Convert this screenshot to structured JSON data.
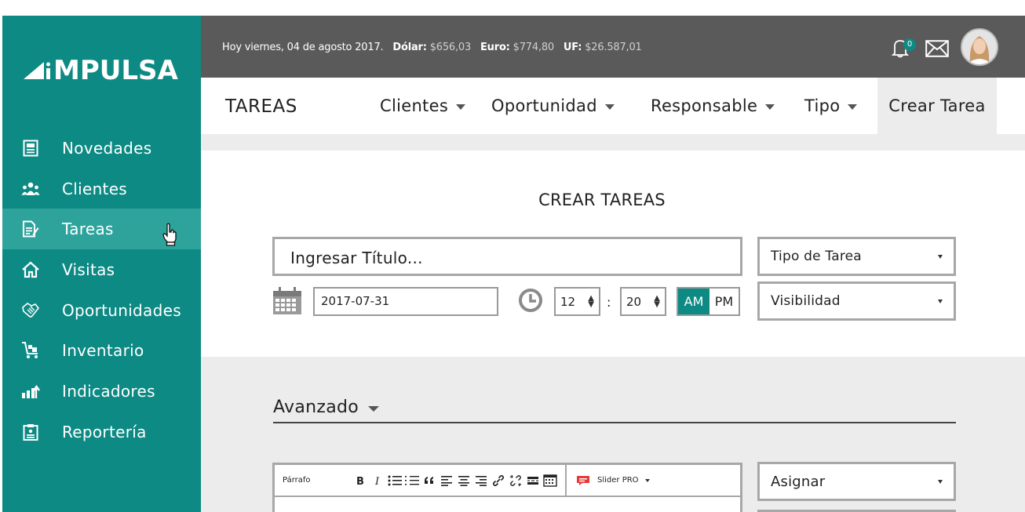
{
  "brand": {
    "name": "IMPULSA",
    "color": "#0e8a84"
  },
  "sidebar": {
    "items": [
      {
        "label": "Novedades",
        "icon": "newspaper-icon"
      },
      {
        "label": "Clientes",
        "icon": "users-icon"
      },
      {
        "label": "Tareas",
        "icon": "task-edit-icon",
        "active": true
      },
      {
        "label": "Visitas",
        "icon": "home-icon"
      },
      {
        "label": "Oportunidades",
        "icon": "handshake-icon"
      },
      {
        "label": "Inventario",
        "icon": "cart-icon"
      },
      {
        "label": "Indicadores",
        "icon": "bar-chart-icon"
      },
      {
        "label": "Reportería",
        "icon": "clipboard-icon"
      }
    ]
  },
  "topbar": {
    "date_text": "Hoy viernes, 04 de agosto 2017.",
    "dolar_label": "Dólar:",
    "dolar_value": "$656,03",
    "euro_label": "Euro:",
    "euro_value": "$774,80",
    "uf_label": "UF:",
    "uf_value": "$26.587,01",
    "notifications_count": "0"
  },
  "section": {
    "title": "TAREAS",
    "menu": [
      "Clientes",
      "Oportunidad",
      "Responsable",
      "Tipo"
    ],
    "create_label": "Crear Tarea"
  },
  "form": {
    "title": "CREAR TAREAS",
    "title_placeholder": "Ingresar Título...",
    "task_type": "Tipo de Tarea",
    "visibility": "Visibilidad",
    "date": "2017-07-31",
    "hour": "12",
    "minute": "20",
    "colon": ":",
    "am_label": "AM",
    "pm_label": "PM",
    "selected_period": "AM"
  },
  "advanced": {
    "title": "Avanzado",
    "editor_format": "Párrafo",
    "slider_label": "Slider PRO",
    "assign": "Asignar"
  }
}
